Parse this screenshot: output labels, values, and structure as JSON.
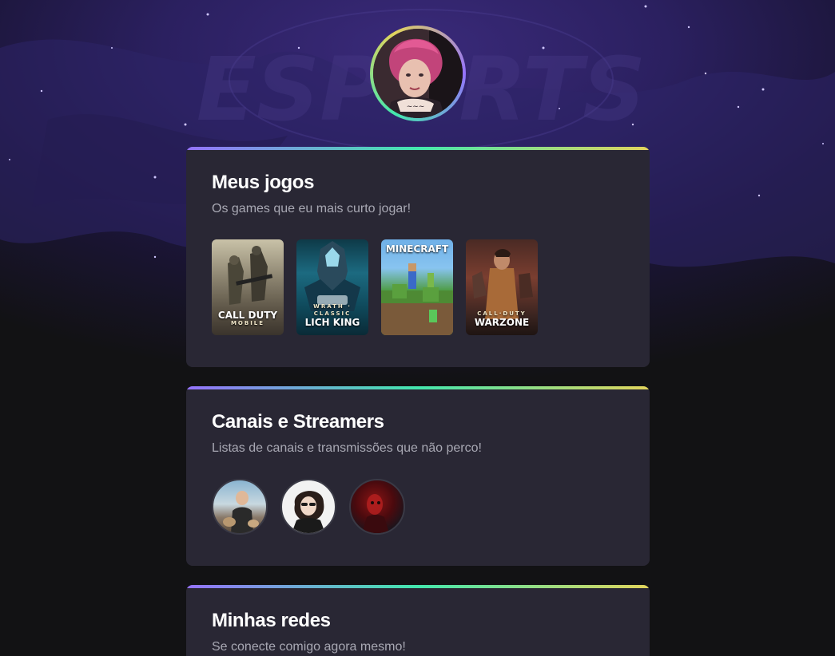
{
  "profile": {
    "avatar_icon": "profile-photo"
  },
  "sections": {
    "games": {
      "title": "Meus jogos",
      "subtitle": "Os games que eu mais curto jogar!",
      "items": [
        {
          "title": "CALL DUTY",
          "sub": "MOBILE",
          "icon": "call-of-duty-mobile-cover"
        },
        {
          "title": "LICH KING",
          "sub": "WRATH · CLASSIC",
          "icon": "wow-wrath-lich-king-cover"
        },
        {
          "title": "MINECRAFT",
          "sub": "",
          "icon": "minecraft-cover"
        },
        {
          "title": "WARZONE",
          "sub": "CALL·DUTY",
          "icon": "warzone-cover"
        }
      ]
    },
    "streamers": {
      "title": "Canais e Streamers",
      "subtitle": "Listas de canais e transmissões que não perco!",
      "items": [
        {
          "icon": "streamer-avatar-1"
        },
        {
          "icon": "streamer-avatar-2"
        },
        {
          "icon": "streamer-avatar-3"
        }
      ]
    },
    "networks": {
      "title": "Minhas redes",
      "subtitle": "Se conecte comigo agora mesmo!"
    }
  },
  "colors": {
    "accent_purple": "#9572fc",
    "accent_green": "#43e7ad",
    "accent_yellow": "#e2d45c",
    "card_bg": "#292734",
    "page_bg": "#121214"
  }
}
